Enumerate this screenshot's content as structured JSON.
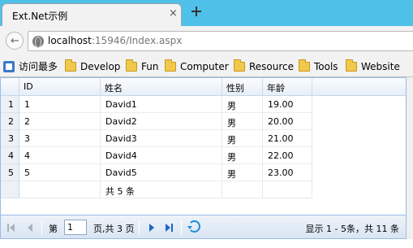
{
  "browser": {
    "tab_title": "Ext.Net示例",
    "tab_close": "×",
    "url_host": "localhost",
    "url_rest": ":15946/Index.aspx"
  },
  "bookmarks": {
    "most_visited": "访问最多",
    "folders": [
      "Develop",
      "Fun",
      "Computer",
      "Resource",
      "Tools",
      "Website"
    ]
  },
  "grid": {
    "columns": [
      "ID",
      "姓名",
      "性别",
      "年龄"
    ],
    "rows": [
      {
        "num": "1",
        "id": "1",
        "name": "David1",
        "gender": "男",
        "age": "19.00"
      },
      {
        "num": "2",
        "id": "2",
        "name": "David2",
        "gender": "男",
        "age": "20.00"
      },
      {
        "num": "3",
        "id": "3",
        "name": "David3",
        "gender": "男",
        "age": "21.00"
      },
      {
        "num": "4",
        "id": "4",
        "name": "David4",
        "gender": "男",
        "age": "22.00"
      },
      {
        "num": "5",
        "id": "5",
        "name": "David5",
        "gender": "男",
        "age": "23.00"
      }
    ],
    "summary": "共 5 条"
  },
  "pager": {
    "page_label": "第",
    "page_value": "1",
    "page_suffix": "页,共 3 页",
    "display": "显示 1 - 5条，共 11 条"
  },
  "colors": {
    "tabstrip": "#4fc1e9",
    "grid_border": "#99bbe8",
    "pager_icon": "#1a66c8"
  }
}
